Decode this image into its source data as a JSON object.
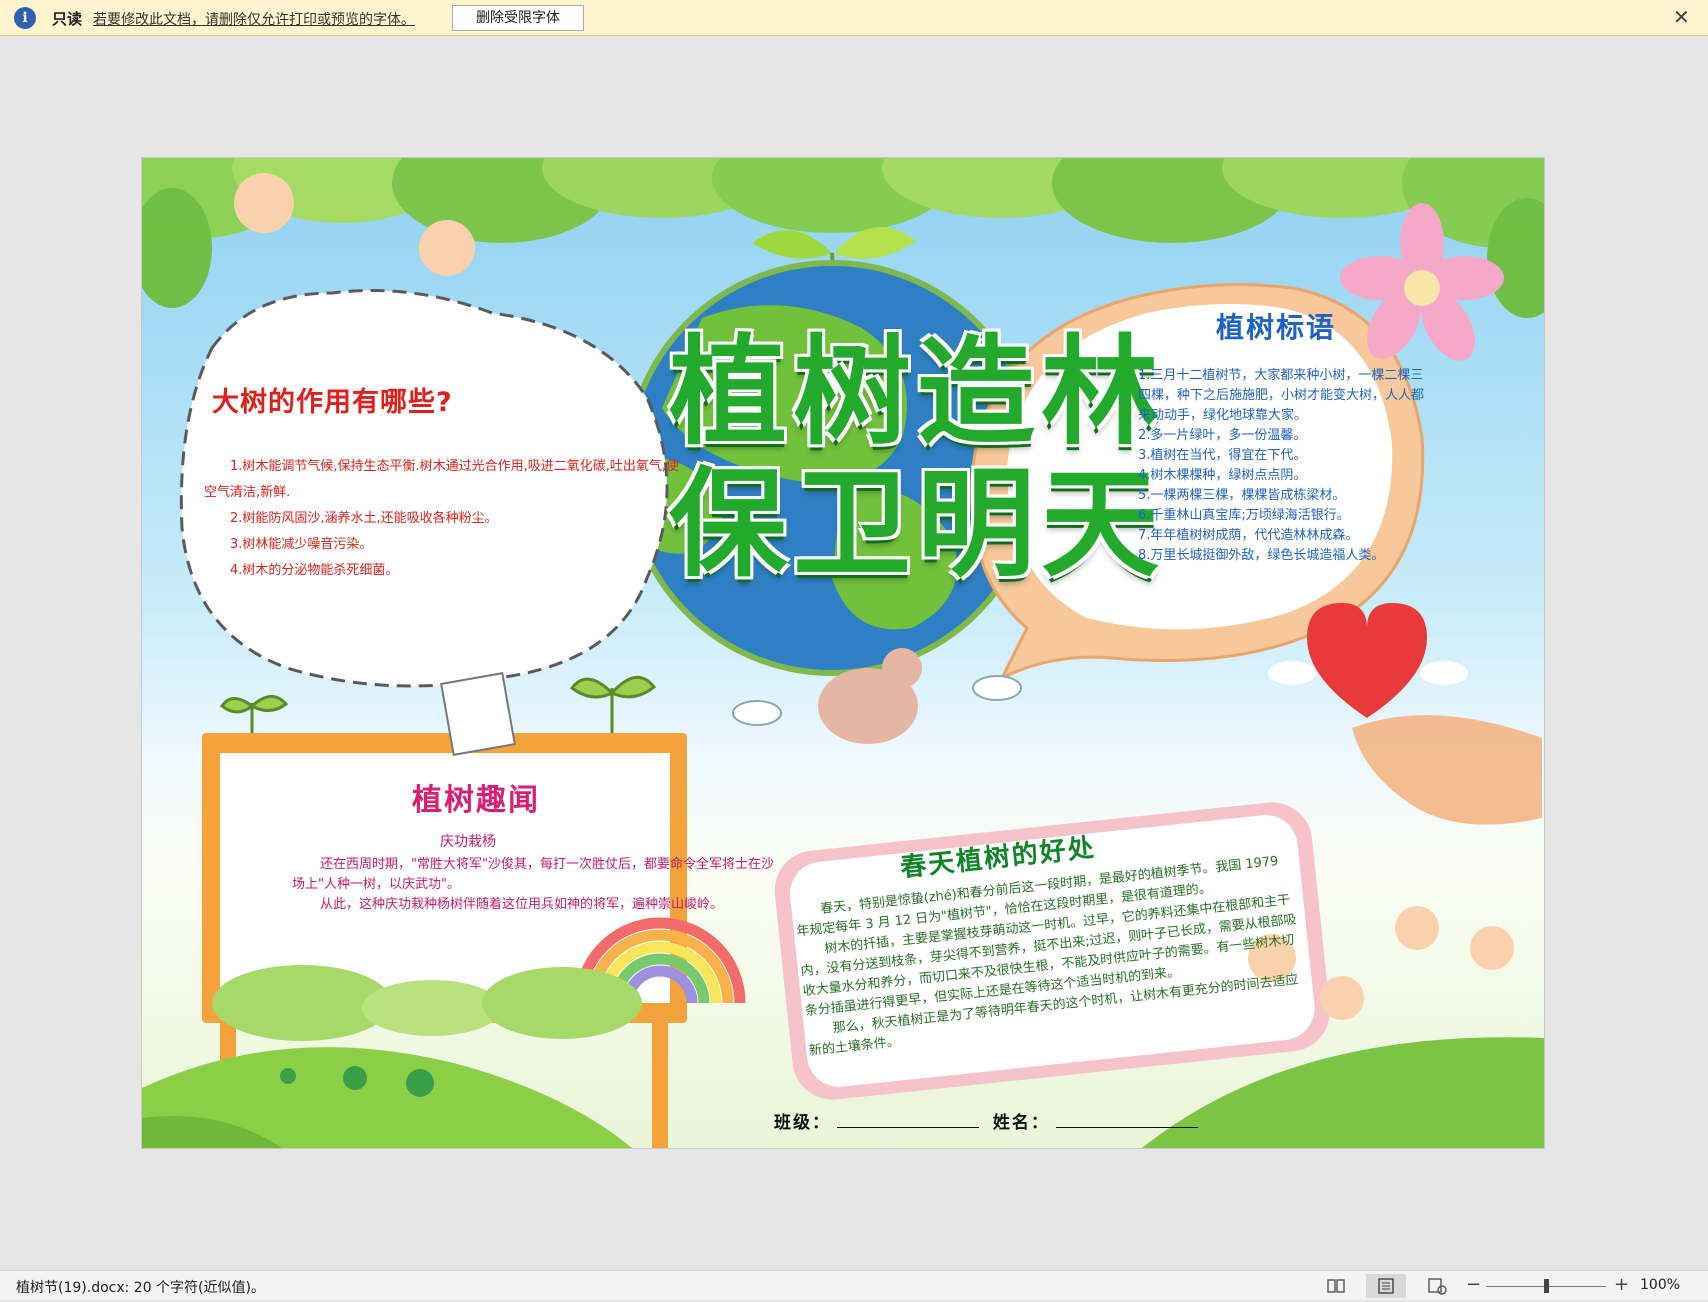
{
  "message_bar": {
    "info_icon": "info-icon",
    "status_label": "只读",
    "message": "若要修改此文档，请删除仅允许打印或预览的字体。",
    "action_button": "删除受限字体",
    "close_icon": "close-icon",
    "close_glyph": "✕"
  },
  "document": {
    "headline_line1": "植树造林",
    "headline_line2": "保卫明天",
    "left_bubble": {
      "title": "大树的作用有哪些?",
      "items": [
        "1.树木能调节气候,保持生态平衡.树木通过光合作用,吸进二氧化碳,吐出氧气,使空气清洁,新鲜.",
        "2.树能防风固沙,涵养水土,还能吸收各种粉尘。",
        "3.树林能减少噪音污染。",
        "4.树木的分泌物能杀死细菌。"
      ]
    },
    "right_bubble": {
      "title": "植树标语",
      "items": [
        "1.三月十二植树节，大家都来种小树，一棵二棵三四棵，种下之后施施肥，小树才能变大树，人人都来动动手，绿化地球靠大家。",
        "2.多一片绿叶，多一份温馨。",
        "3.植树在当代，得宜在下代。",
        "4.树木棵棵种，绿树点点阴。",
        "5.一棵两棵三棵，棵棵皆成栋梁材。",
        "6.千重林山真宝库;万顷绿海活银行。",
        "7.年年植树树成荫，代代造林林成森。",
        "8.万里长城挺御外敌，绿色长城造福人类。"
      ]
    },
    "bottom_left": {
      "title": "植树趣闻",
      "subtitle": "庆功栽杨",
      "paragraphs": [
        "还在西周时期，\"常胜大将军\"沙俊其，每打一次胜仗后，都要命令全军将士在沙场上\"人种一树，以庆武功\"。",
        "从此，这种庆功栽种杨树伴随着这位用兵如神的将军，遍种崇山峻岭。"
      ]
    },
    "bottom_right": {
      "title": "春天植树的好处",
      "paragraphs": [
        "春天，特别是惊蛰(zhé)和春分前后这一段时期，是最好的植树季节。我国 1979 年规定每年 3 月 12 日为\"植树节\"，恰恰在这段时期里，是很有道理的。",
        "树木的扦插，主要是掌握枝芽萌动这一时机。过早，它的养料还集中在根部和主干内，没有分送到枝条，芽尖得不到营养，挺不出来;过迟，则叶子已长成，需要从根部吸收大量水分和养分，而切口来不及很快生根，不能及时供应叶子的需要。有一些树木切条分插虽进行得更早，但实际上还是在等待这个适当时机的到来。",
        "那么，秋天植树正是为了等待明年春天的这个时机，让树木有更充分的时间去适应新的土壤条件。"
      ]
    },
    "class_label": "班级：",
    "name_label": "姓名：",
    "return_mark": "↵"
  },
  "status_bar": {
    "doc_info": "植树节(19).docx: 20 个字符(近似值)。",
    "view_icons": [
      "read-mode-icon",
      "print-layout-icon",
      "web-layout-icon"
    ],
    "zoom_minus": "−",
    "zoom_plus": "+",
    "zoom_percent": 100,
    "zoom_level": "100%"
  },
  "colors": {
    "message_bar_bg": "#fff4ce",
    "headline_green": "#23a92c",
    "left_text_red": "#e0201c",
    "right_text_blue": "#1f62c8",
    "bottom_left_pink": "#c81a6b",
    "bottom_right_green": "#12852a"
  }
}
